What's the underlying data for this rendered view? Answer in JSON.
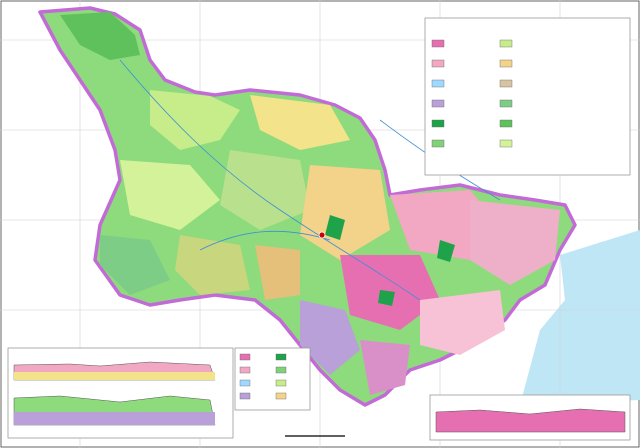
{
  "map": {
    "title": "",
    "legend": {
      "title": "",
      "sections": [],
      "swatch_colors": [
        "#e66fb2",
        "#f2a7c2",
        "#9fd9ff",
        "#b9a0d9",
        "#1fa34a",
        "#7fd27a",
        "#c7ec8a",
        "#f3d28a",
        "#d8c4a3",
        "#7dcd86",
        "#5fc15b",
        "#d3f29a"
      ]
    },
    "profiles": [
      {
        "title": ""
      },
      {
        "title": ""
      },
      {
        "title": ""
      }
    ],
    "scale_text": "",
    "watermark": "",
    "colors": {
      "province_boundary": "#c26bd6",
      "sea": "#bfe6f5",
      "rock_green": "#7fd27a",
      "rock_pink": "#f2a7c2",
      "rock_yellow": "#f3e38a",
      "outside": "#ffffff"
    }
  }
}
